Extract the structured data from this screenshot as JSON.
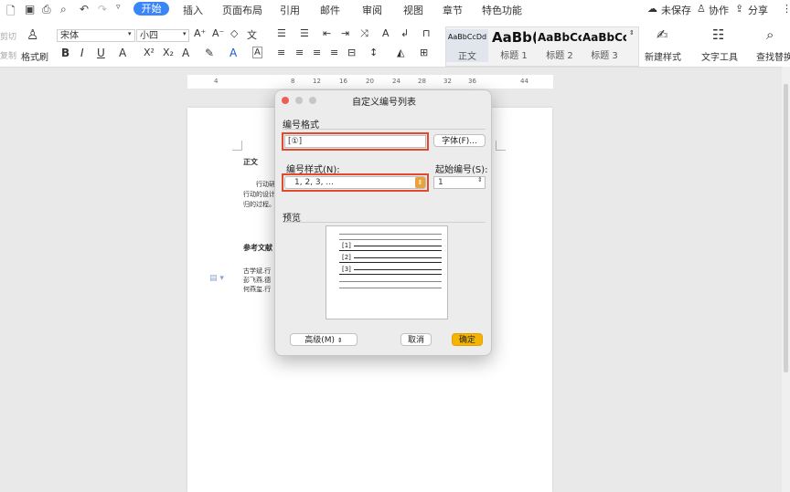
{
  "menubar": {
    "active_tab": "开始",
    "tabs": [
      "插入",
      "页面布局",
      "引用",
      "邮件",
      "审阅",
      "视图",
      "章节",
      "特色功能"
    ],
    "right": {
      "unsaved": "未保存",
      "collab": "协作",
      "share": "分享"
    }
  },
  "ribbon": {
    "cut_label": "剪切",
    "copy_label": "复制",
    "format_painter_label": "格式刷",
    "font_name": "宋体",
    "font_size": "小四",
    "styles": [
      {
        "sample": "AaBbCcDd",
        "label": "正文"
      },
      {
        "sample": "AaBb(",
        "label": "标题 1"
      },
      {
        "sample": "AaBbCc",
        "label": "标题 2"
      },
      {
        "sample": "AaBbCc",
        "label": "标题 3"
      }
    ],
    "new_style_label": "新建样式",
    "text_tools_label": "文字工具",
    "find_replace_label": "查找替换"
  },
  "ruler": {
    "ticks": [
      "4",
      "8",
      "12",
      "16",
      "20",
      "24",
      "28",
      "32",
      "36",
      "44"
    ]
  },
  "document": {
    "heading_body": "正文",
    "body_lines": [
      "行动研",
      "行动的设计",
      "归的过程。"
    ],
    "heading_refs": "参考文献",
    "ref_lines": [
      "古学斌.行",
      "彭飞燕.德",
      "何燕玺.行"
    ]
  },
  "dialog": {
    "title": "自定义编号列表",
    "format_section": "编号格式",
    "format_value": "[①]",
    "font_button": "字体(F)...",
    "style_label": "编号样式(N):",
    "style_value": "1, 2, 3, ...",
    "start_label": "起始编号(S):",
    "start_value": "1",
    "preview_label": "预览",
    "preview_numbers": [
      "[1]",
      "[2]",
      "[3]"
    ],
    "advanced_button": "高级(M)",
    "cancel_button": "取消",
    "ok_button": "确定"
  },
  "colors": {
    "accent": "#3b86f7",
    "ok": "#f5b400",
    "highlight": "#e3492c"
  }
}
